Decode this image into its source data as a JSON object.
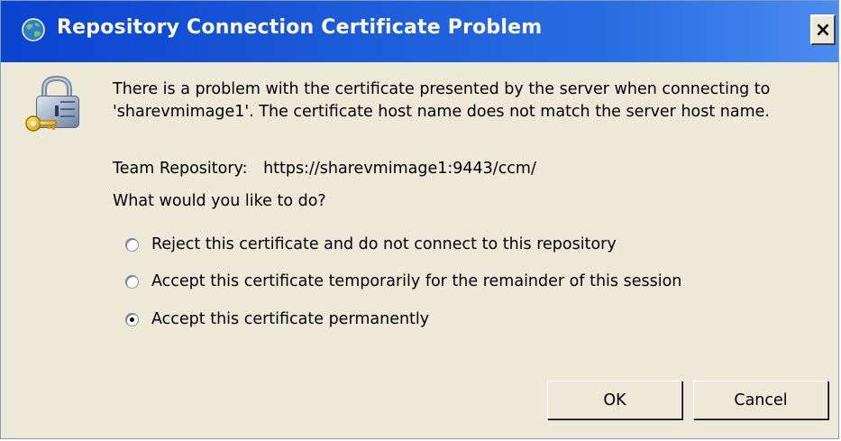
{
  "dialog": {
    "title": "Repository Connection Certificate Problem",
    "close_label": "×",
    "title_icon": "globe-icon",
    "warning_icon": "lock-key-icon"
  },
  "message": "There is a problem with the certificate presented by the server when connecting to 'sharevmimage1'. The certificate host name does not match the server host name.",
  "repository": {
    "label": "Team Repository:",
    "url": "https://sharevmimage1:9443/ccm/"
  },
  "question": "What would you like to do?",
  "options": [
    {
      "label": "Reject this certificate and do not connect to this repository",
      "selected": false
    },
    {
      "label": "Accept this certificate temporarily for the remainder of this session",
      "selected": false
    },
    {
      "label": "Accept this certificate permanently",
      "selected": true
    }
  ],
  "buttons": {
    "ok_label": "OK",
    "cancel_label": "Cancel"
  },
  "colors": {
    "titlebar": "#1b5ad8",
    "background": "#ece9d8"
  }
}
